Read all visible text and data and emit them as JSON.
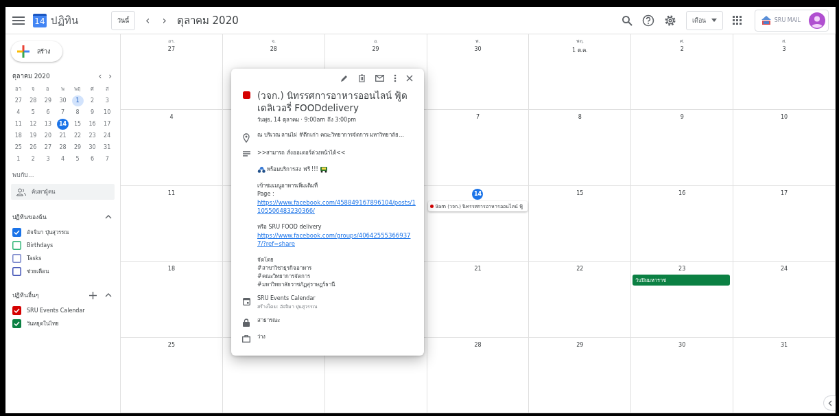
{
  "header": {
    "app_icon_day": "14",
    "title": "ปฏิทิน",
    "today_button": "วันนี้",
    "prev": "‹",
    "next": "›",
    "period": "ตุลาคม 2020",
    "view_button": "เดือน",
    "account_logo": "SRU MAIL"
  },
  "sidebar": {
    "create_button": "สร้าง",
    "mini_calendar": {
      "title": "ตุลาคม 2020",
      "weekdays": [
        "อา",
        "จ",
        "อ",
        "พ",
        "พฤ",
        "ศ",
        "ส"
      ],
      "days": [
        {
          "label": "27",
          "selected": false,
          "today": false
        },
        {
          "label": "28",
          "selected": false,
          "today": false
        },
        {
          "label": "29",
          "selected": false,
          "today": false
        },
        {
          "label": "30",
          "selected": false,
          "today": false
        },
        {
          "label": "1",
          "selected": true,
          "today": false
        },
        {
          "label": "2",
          "selected": false,
          "today": false
        },
        {
          "label": "3",
          "selected": false,
          "today": false
        },
        {
          "label": "4",
          "selected": false,
          "today": false
        },
        {
          "label": "5",
          "selected": false,
          "today": false
        },
        {
          "label": "6",
          "selected": false,
          "today": false
        },
        {
          "label": "7",
          "selected": false,
          "today": false
        },
        {
          "label": "8",
          "selected": false,
          "today": false
        },
        {
          "label": "9",
          "selected": false,
          "today": false
        },
        {
          "label": "10",
          "selected": false,
          "today": false
        },
        {
          "label": "11",
          "selected": false,
          "today": false
        },
        {
          "label": "12",
          "selected": false,
          "today": false
        },
        {
          "label": "13",
          "selected": false,
          "today": false
        },
        {
          "label": "14",
          "selected": false,
          "today": true
        },
        {
          "label": "15",
          "selected": false,
          "today": false
        },
        {
          "label": "16",
          "selected": false,
          "today": false
        },
        {
          "label": "17",
          "selected": false,
          "today": false
        },
        {
          "label": "18",
          "selected": false,
          "today": false
        },
        {
          "label": "19",
          "selected": false,
          "today": false
        },
        {
          "label": "20",
          "selected": false,
          "today": false
        },
        {
          "label": "21",
          "selected": false,
          "today": false
        },
        {
          "label": "22",
          "selected": false,
          "today": false
        },
        {
          "label": "23",
          "selected": false,
          "today": false
        },
        {
          "label": "24",
          "selected": false,
          "today": false
        },
        {
          "label": "25",
          "selected": false,
          "today": false
        },
        {
          "label": "26",
          "selected": false,
          "today": false
        },
        {
          "label": "27",
          "selected": false,
          "today": false
        },
        {
          "label": "28",
          "selected": false,
          "today": false
        },
        {
          "label": "29",
          "selected": false,
          "today": false
        },
        {
          "label": "30",
          "selected": false,
          "today": false
        },
        {
          "label": "31",
          "selected": false,
          "today": false
        },
        {
          "label": "1",
          "selected": false,
          "today": false
        },
        {
          "label": "2",
          "selected": false,
          "today": false
        },
        {
          "label": "3",
          "selected": false,
          "today": false
        },
        {
          "label": "4",
          "selected": false,
          "today": false
        },
        {
          "label": "5",
          "selected": false,
          "today": false
        },
        {
          "label": "6",
          "selected": false,
          "today": false
        },
        {
          "label": "7",
          "selected": false,
          "today": false
        }
      ]
    },
    "meet_title": "พบกับ...",
    "people_search": {
      "placeholder": "ค้นหาผู้คน"
    },
    "groups": [
      {
        "title": "ปฏิทินของฉัน",
        "expanded": true,
        "add": false,
        "calendars": [
          {
            "name": "อัจจิมา ปุ่นสุวรรณ",
            "checked": true,
            "color": "#1a73e8"
          },
          {
            "name": "Birthdays",
            "checked": false,
            "color": "#33b679"
          },
          {
            "name": "Tasks",
            "checked": false,
            "color": "#7986cb"
          },
          {
            "name": "ช่วยเตือน",
            "checked": false,
            "color": "#3f51b5"
          }
        ]
      },
      {
        "title": "ปฏิทินอื่นๆ",
        "expanded": true,
        "add": true,
        "calendars": [
          {
            "name": "SRU Events Calendar",
            "checked": true,
            "color": "#d50000"
          },
          {
            "name": "วันหยุดในไทย",
            "checked": true,
            "color": "#0b8043"
          }
        ]
      }
    ]
  },
  "month": {
    "columns": [
      {
        "weekday": "อา.",
        "days": [
          {
            "label": "27",
            "today": false
          },
          {
            "label": "4",
            "today": false
          },
          {
            "label": "11",
            "today": false
          },
          {
            "label": "18",
            "today": false
          },
          {
            "label": "25",
            "today": false
          }
        ]
      },
      {
        "weekday": "จ.",
        "days": [
          {
            "label": "28",
            "today": false
          }
        ]
      },
      {
        "weekday": "อ.",
        "days": [
          {
            "label": "29",
            "today": false
          }
        ]
      },
      {
        "weekday": "พ.",
        "days": [
          {
            "label": "30",
            "today": false
          },
          {
            "label": "7",
            "today": false
          },
          {
            "label": "14",
            "today": true,
            "events": [
              {
                "kind": "timed",
                "text": "9am (วจก.) นิทรรศการอาหารออนไลน์ ฟู้",
                "color": "#d50000"
              }
            ]
          },
          {
            "label": "21",
            "today": false
          },
          {
            "label": "28",
            "today": false
          }
        ]
      },
      {
        "weekday": "พฤ.",
        "days": [
          {
            "label": "1 ต.ค.",
            "today": false
          },
          {
            "label": "8",
            "today": false
          },
          {
            "label": "15",
            "today": false
          },
          {
            "label": "22",
            "today": false
          },
          {
            "label": "29",
            "today": false
          }
        ]
      },
      {
        "weekday": "ศ.",
        "days": [
          {
            "label": "2",
            "today": false
          },
          {
            "label": "9",
            "today": false
          },
          {
            "label": "16",
            "today": false
          },
          {
            "label": "23",
            "today": false,
            "events": [
              {
                "kind": "allday",
                "text": "วันปิยมหาราช",
                "color": "#0b8043"
              }
            ]
          },
          {
            "label": "30",
            "today": false
          }
        ]
      },
      {
        "weekday": "ส.",
        "days": [
          {
            "label": "3",
            "today": false
          },
          {
            "label": "10",
            "today": false
          },
          {
            "label": "17",
            "today": false
          },
          {
            "label": "24",
            "today": false
          },
          {
            "label": "31",
            "today": false
          }
        ]
      }
    ]
  },
  "event_popup": {
    "color": "#d50000",
    "title": "(วจก.) นิทรรศการอาหารออนไลน์ ฟู้ดเดลิเวอรี่ FOODdelivery",
    "when": "วันพุธ, 14 ตุลาคม  ·  9:00am ถึง 3:00pm",
    "location": "ณ บริเวณ ลานไผ่ #ตึกเก่า คณะวิทยาการจัดการ มหาวิทยาลัย...",
    "description": [
      [
        {
          "kind": "text",
          "text": ">>สามารถ สั่งออเดอร์ล่วงหน้าได้<<"
        }
      ],
      [
        {
          "kind": "icon_text",
          "text": "พร้อมบริการส่ง ฟรี !!!"
        }
      ],
      [
        {
          "kind": "text",
          "text": "เข้าชมเมนูอาหารเพิ่มเติมที่"
        },
        {
          "kind": "text",
          "text": "Page :"
        },
        {
          "kind": "link",
          "text": "https://www.facebook.com/458849167896104/posts/1105506483230366/"
        }
      ],
      [
        {
          "kind": "text",
          "text": "หรือ SRU FOOD delivery"
        },
        {
          "kind": "link",
          "text": "https://www.facebook.com/groups/406425553669377/?ref=share"
        }
      ],
      [
        {
          "kind": "text",
          "text": "จัดโดย"
        },
        {
          "kind": "text",
          "text": "#สาขาวิชาธุรกิจอาหาร"
        },
        {
          "kind": "text",
          "text": "#คณะวิทยาการจัดการ"
        },
        {
          "kind": "text",
          "text": "#มหาวิทยาลัยราชภัฏสุราษฎร์ธานี"
        }
      ]
    ],
    "calendar": "SRU Events Calendar",
    "created_by": "สร้างโดย: อัจจิมา ปุ่นสุวรรณ",
    "visibility": "สาธารณะ",
    "availability": "ว่าง"
  }
}
